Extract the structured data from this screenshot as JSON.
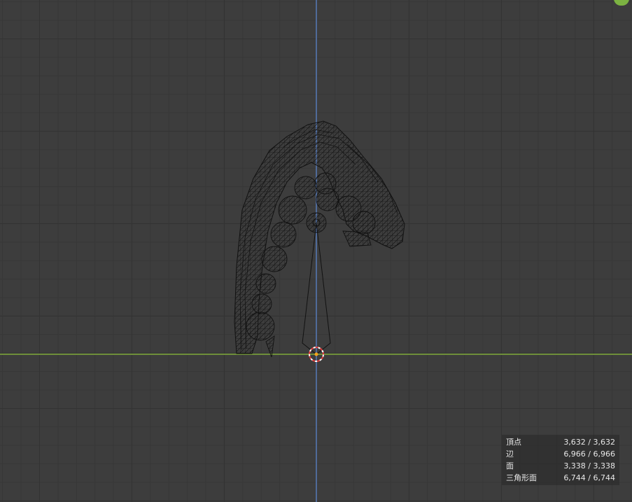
{
  "viewport": {
    "mode": "wireframe",
    "background_color": "#3d3d3d",
    "x_axis_color": "#6e8f3a",
    "z_axis_color": "#4f6a99",
    "wire_color": "#111111"
  },
  "statistics": {
    "rows": [
      {
        "label": "頂点",
        "value": "3,632 / 3,632"
      },
      {
        "label": "辺",
        "value": "6,966 / 6,966"
      },
      {
        "label": "面",
        "value": "3,338 / 3,338"
      },
      {
        "label": "三角形面",
        "value": "6,744 / 6,744"
      }
    ]
  },
  "gizmo": {
    "badge_color": "#7cb342",
    "cursor_color": "#e03c3c"
  }
}
